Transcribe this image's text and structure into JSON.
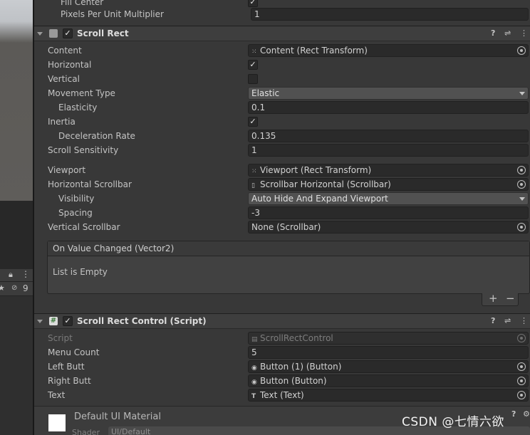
{
  "top_rows": [
    {
      "label": "Fill Center",
      "checked": "✓"
    },
    {
      "label": "Pixels Per Unit Multiplier",
      "value": "1"
    }
  ],
  "scroll_rect": {
    "title": "Scroll Rect",
    "enabled": "✓",
    "content_label": "Content",
    "content_value": "Content (Rect Transform)",
    "horizontal_label": "Horizontal",
    "horizontal_check": "✓",
    "vertical_label": "Vertical",
    "movement_label": "Movement Type",
    "movement_value": "Elastic",
    "elasticity_label": "Elasticity",
    "elasticity_value": "0.1",
    "inertia_label": "Inertia",
    "inertia_check": "✓",
    "decel_label": "Deceleration Rate",
    "decel_value": "0.135",
    "sensitivity_label": "Scroll Sensitivity",
    "sensitivity_value": "1",
    "viewport_label": "Viewport",
    "viewport_value": "Viewport (Rect Transform)",
    "hscroll_label": "Horizontal Scrollbar",
    "hscroll_value": "Scrollbar Horizontal (Scrollbar)",
    "visibility_label": "Visibility",
    "visibility_value": "Auto Hide And Expand Viewport",
    "spacing_label": "Spacing",
    "spacing_value": "-3",
    "vscroll_label": "Vertical Scrollbar",
    "vscroll_value": "None (Scrollbar)",
    "event_title": "On Value Changed (Vector2)",
    "event_empty": "List is Empty",
    "add_label": "+",
    "remove_label": "−"
  },
  "script_comp": {
    "title": "Scroll Rect Control (Script)",
    "enabled": "✓",
    "script_label": "Script",
    "script_value": "ScrollRectControl",
    "menu_label": "Menu Count",
    "menu_value": "5",
    "left_label": "Left Butt",
    "left_value": "Button (1) (Button)",
    "right_label": "Right Butt",
    "right_value": "Button (Button)",
    "text_label": "Text",
    "text_value": "Text (Text)"
  },
  "material": {
    "name": "Default UI Material",
    "shader_label": "Shader",
    "shader_value": "UI/Default"
  },
  "left_panel": {
    "count": "9"
  },
  "header_icons": {
    "help": "?",
    "presets": "⇌",
    "menu": "⋮"
  },
  "watermark": "CSDN @七情六欲",
  "colors": {
    "background": "#383838",
    "header": "#3e3e3e",
    "field": "#2a2a2a",
    "text": "#c4c4c4"
  }
}
